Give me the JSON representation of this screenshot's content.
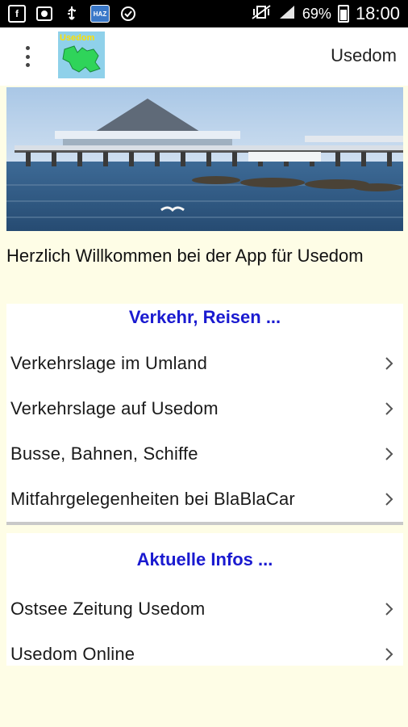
{
  "status_bar": {
    "icons": [
      "facebook-icon",
      "screenshot-icon",
      "usb-debug-icon",
      "haz-app-icon",
      "sync-icon"
    ],
    "haz_label": "HAZ",
    "battery": "69%",
    "time": "18:00"
  },
  "app_bar": {
    "logo_text": "Usedom",
    "title": "Usedom"
  },
  "welcome_text": "Herzlich Willkommen bei der App für Usedom",
  "sections": [
    {
      "title": "Verkehr, Reisen ...",
      "items": [
        {
          "label": "Verkehrslage im Umland"
        },
        {
          "label": "Verkehrslage auf Usedom"
        },
        {
          "label": "Busse, Bahnen, Schiffe"
        },
        {
          "label": "Mitfahrgelegenheiten bei BlaBlaCar"
        }
      ]
    },
    {
      "title": "Aktuelle Infos ...",
      "items": [
        {
          "label": "Ostsee Zeitung Usedom"
        },
        {
          "label": "Usedom Online"
        }
      ]
    }
  ],
  "colors": {
    "background": "#fefde6",
    "section_title": "#1a1ad0"
  }
}
